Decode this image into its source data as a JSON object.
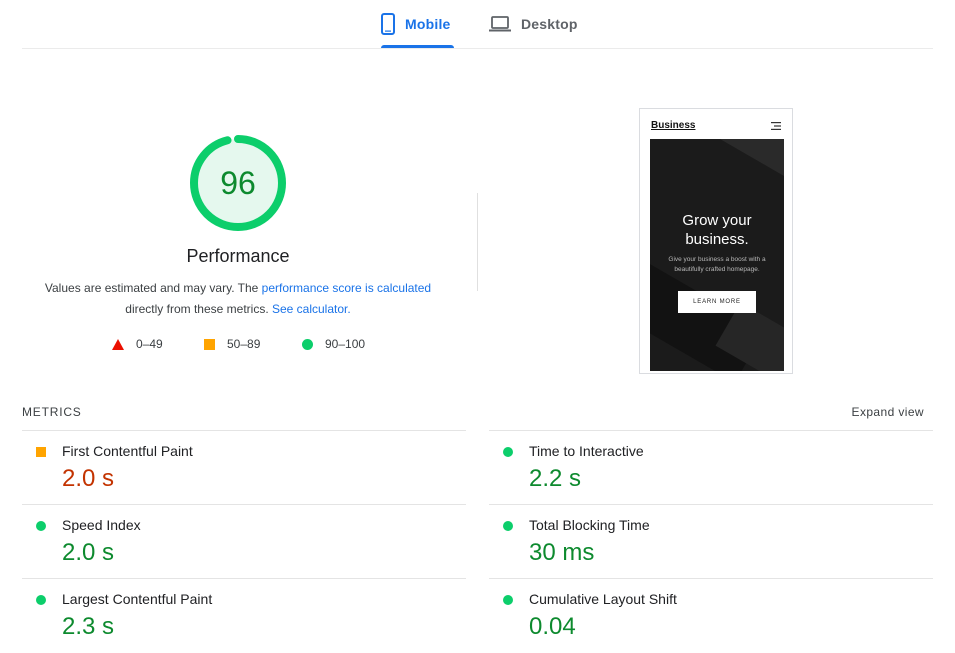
{
  "tabs": {
    "mobile": "Mobile",
    "desktop": "Desktop"
  },
  "performance": {
    "score": "96",
    "score_value": 96,
    "title": "Performance",
    "desc_1": "Values are estimated and may vary. The ",
    "desc_link_1": "performance score is calculated",
    "desc_2": "directly from these metrics. ",
    "desc_link_2": "See calculator."
  },
  "legend": {
    "fail": "0–49",
    "average": "50–89",
    "pass": "90–100"
  },
  "screenshot": {
    "logo": "Business",
    "hero_title_1": "Grow your",
    "hero_title_2": "business.",
    "hero_sub_1": "Give your business a boost with a",
    "hero_sub_2": "beautifully crafted homepage.",
    "hero_button": "LEARN MORE"
  },
  "metrics": {
    "label": "METRICS",
    "expand": "Expand view",
    "fcp": {
      "name": "First Contentful Paint",
      "value": "2.0 s",
      "rating": "average"
    },
    "tti": {
      "name": "Time to Interactive",
      "value": "2.2 s",
      "rating": "pass"
    },
    "si": {
      "name": "Speed Index",
      "value": "2.0 s",
      "rating": "pass"
    },
    "tbt": {
      "name": "Total Blocking Time",
      "value": "30 ms",
      "rating": "pass"
    },
    "lcp": {
      "name": "Largest Contentful Paint",
      "value": "2.3 s",
      "rating": "pass"
    },
    "cls": {
      "name": "Cumulative Layout Shift",
      "value": "0.04",
      "rating": "pass"
    }
  },
  "colors": {
    "pass": "#0cce6b",
    "average": "#ffa400",
    "fail": "#eb0f00",
    "accent": "#1a73e8"
  }
}
